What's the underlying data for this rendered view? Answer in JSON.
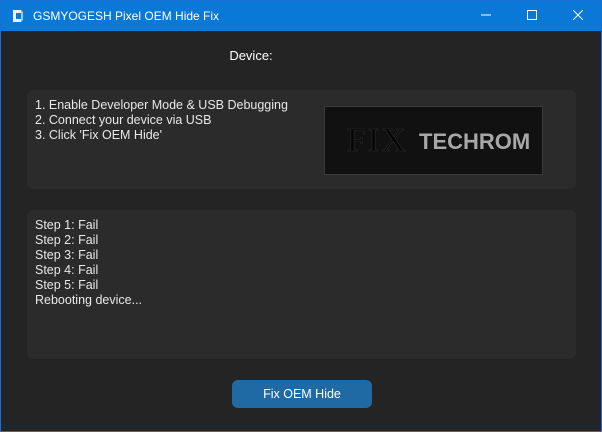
{
  "window": {
    "title": "GSMYOGESH Pixel OEM Hide Fix",
    "accent_color": "#0a78d7",
    "controls": [
      "minimize-icon",
      "maximize-icon",
      "close-icon"
    ]
  },
  "device": {
    "label": "Device:"
  },
  "instructions": {
    "lines": [
      "1. Enable Developer Mode & USB Debugging",
      "2. Connect your device via USB",
      "3. Click 'Fix OEM Hide'"
    ]
  },
  "logo": {
    "text_left": "FIX",
    "text_right": "TECHROM"
  },
  "log": {
    "lines": [
      "Step 1: Fail",
      "Step 2: Fail",
      "Step 3: Fail",
      "Step 4: Fail",
      "Step 5: Fail",
      "Rebooting device..."
    ]
  },
  "actions": {
    "fix_button_label": "Fix OEM Hide",
    "button_color": "#1f6aa5"
  }
}
